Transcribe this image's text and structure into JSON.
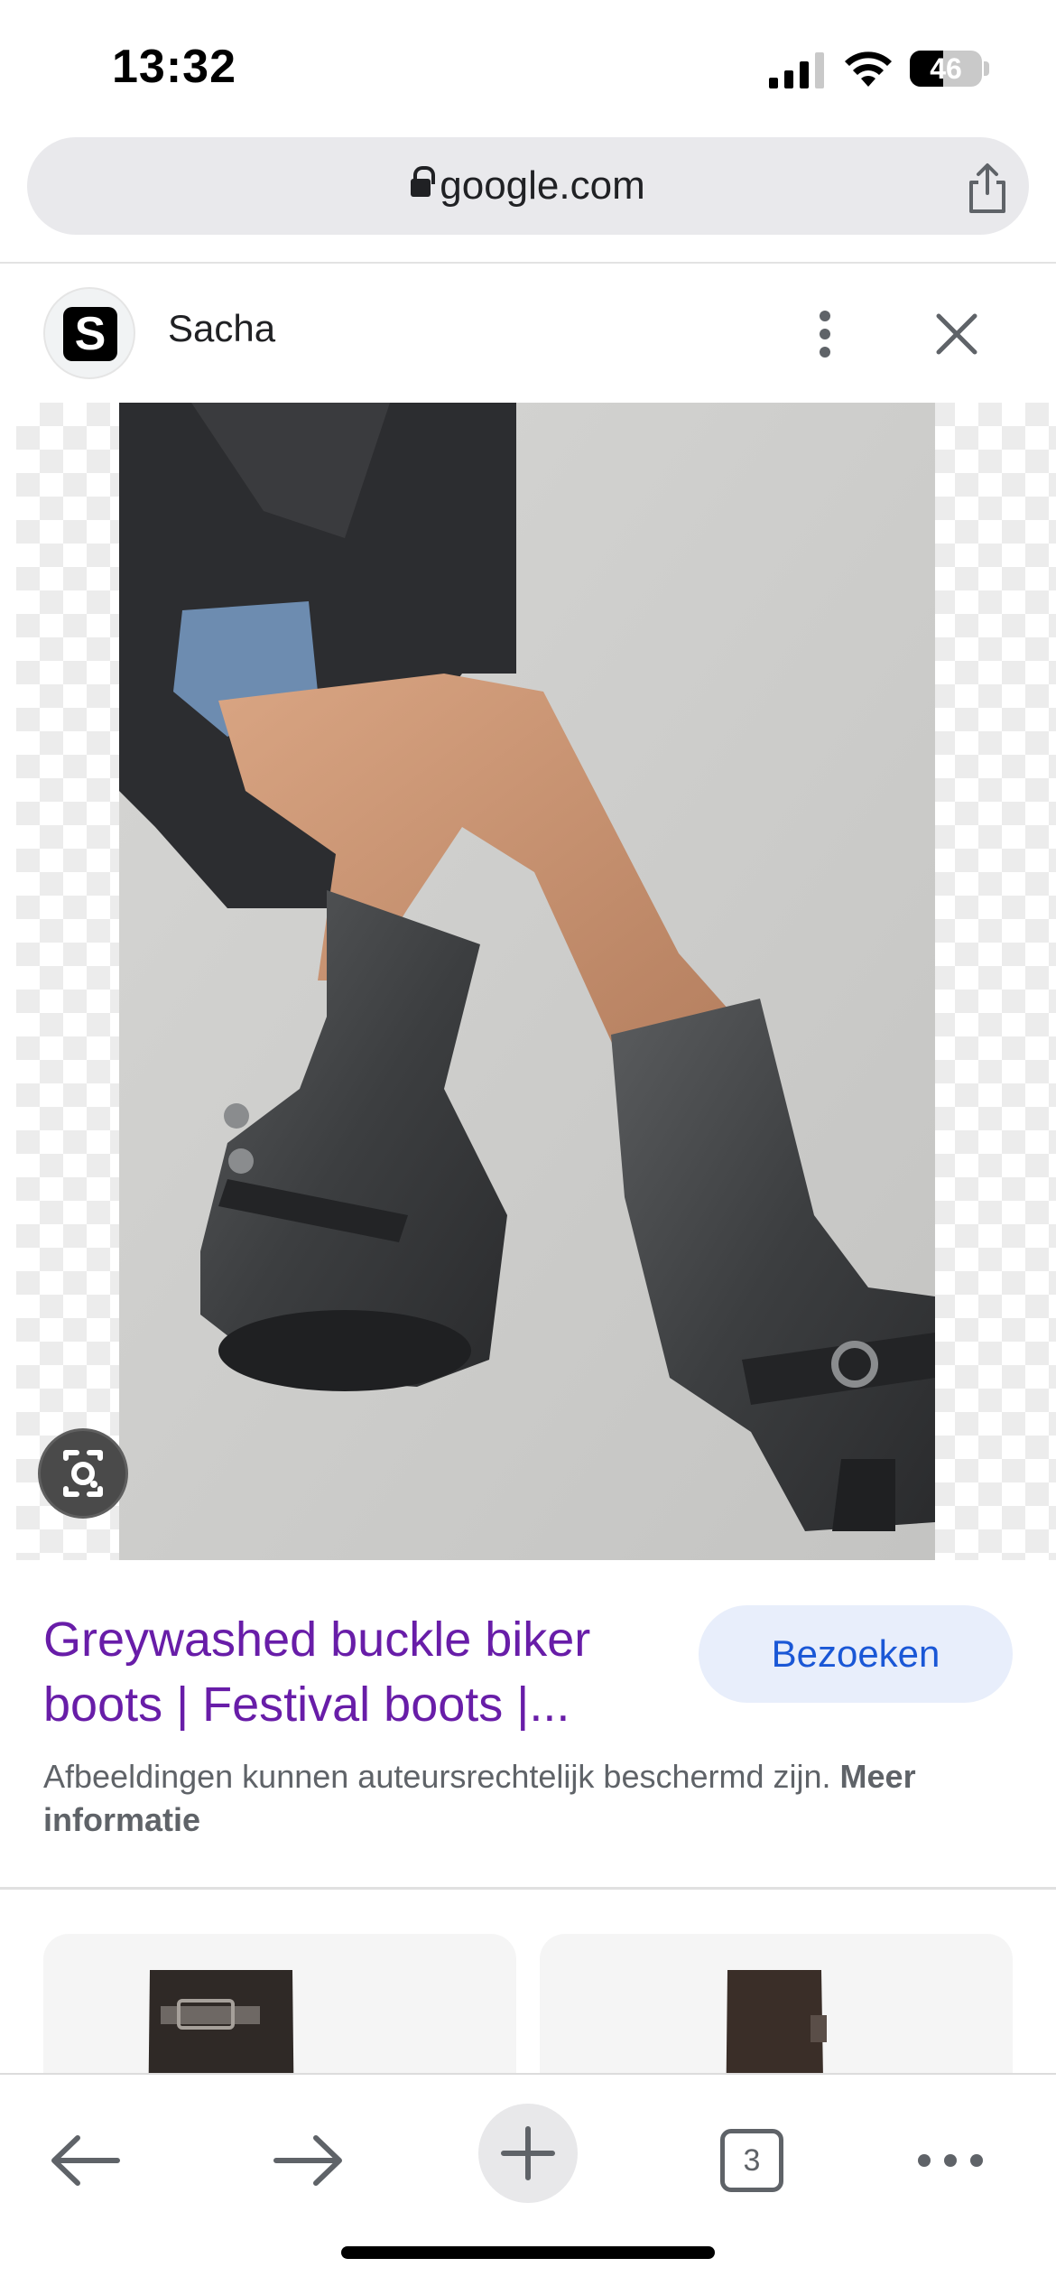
{
  "status_bar": {
    "time": "13:32",
    "battery": "46",
    "battery_level": 0.46,
    "icons": [
      "cellular-signal-icon",
      "wifi-icon",
      "battery-icon"
    ]
  },
  "address_bar": {
    "url": "google.com",
    "icons": [
      "lock-icon",
      "share-icon"
    ]
  },
  "source": {
    "logo_letter": "S",
    "name": "Sacha",
    "icons": [
      "more-vert-icon",
      "close-icon"
    ]
  },
  "image": {
    "lens_icon": "google-lens-icon"
  },
  "result": {
    "title": "Greywashed buckle biker boots | Festival boots |...",
    "visit_label": "Bezoeken",
    "copyright_text": "Afbeeldingen kunnen auteursrechtelijk beschermd zijn.",
    "more_info_link": "Meer informatie"
  },
  "toolbar": {
    "tab_count": "3",
    "icons": [
      "back-arrow-icon",
      "forward-arrow-icon",
      "plus-icon",
      "tabs-icon",
      "more-horiz-icon"
    ]
  },
  "colors": {
    "title_link": "#681da8",
    "visit_button_bg": "#e8eefb",
    "visit_button_text": "#1a57d6"
  }
}
